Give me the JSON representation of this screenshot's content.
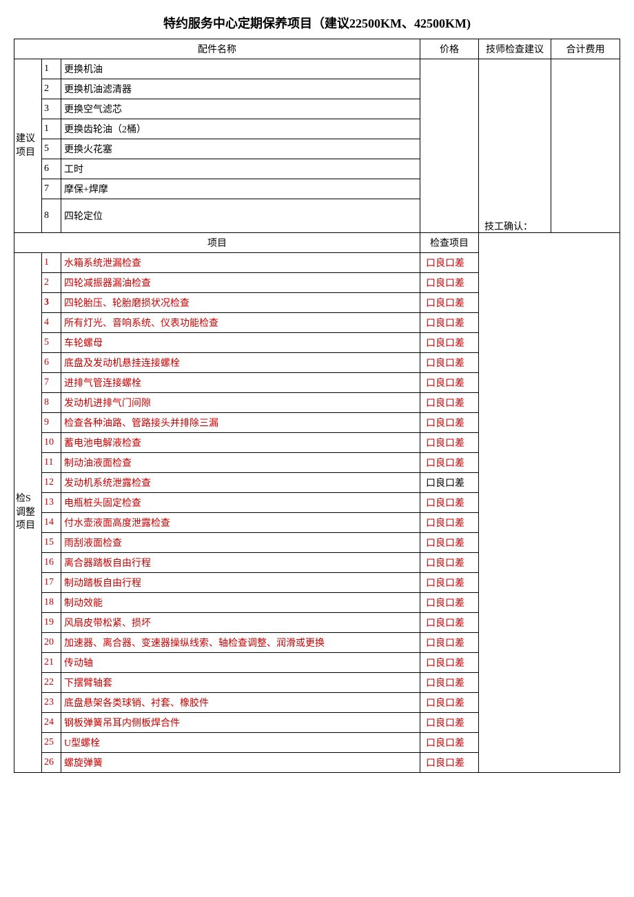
{
  "title": "特约服务中心定期保养项目（建议22500KM、42500KM)",
  "headers": {
    "part_name": "配件名称",
    "price": "价格",
    "advise": "技师检查建议",
    "total": "合计费用",
    "project": "项目",
    "check_project": "检查项目"
  },
  "group1_label": "建议项目",
  "group1": [
    {
      "n": "1",
      "name": "更换机油"
    },
    {
      "n": "2",
      "name": "更换机油滤清器"
    },
    {
      "n": "3",
      "name": "更换空气滤芯"
    },
    {
      "n": "1",
      "name": "更换齿轮油（2桶）"
    },
    {
      "n": "5",
      "name": "更换火花塞"
    },
    {
      "n": "6",
      "name": "工时"
    },
    {
      "n": "7",
      "name": "摩保+焊摩"
    },
    {
      "n": "8",
      "name": "四轮定位"
    }
  ],
  "group2_label": "检S调整项目",
  "check_text": "口良口差",
  "group2": [
    {
      "n": "1",
      "name": "水箱系统泄漏检查"
    },
    {
      "n": "2",
      "name": "四轮减振器漏油检查"
    },
    {
      "n": "3",
      "name": "四轮胎压、轮胎磨损状况检查"
    },
    {
      "n": "4",
      "name": "所有灯光、音响系统、仪表功能检查"
    },
    {
      "n": "5",
      "name": "车轮螺母"
    },
    {
      "n": "6",
      "name": "底盘及发动机悬挂连接螺栓"
    },
    {
      "n": "7",
      "name": "进排气管连接螺栓"
    },
    {
      "n": "8",
      "name": "发动机进排气门间隙"
    },
    {
      "n": "9",
      "name": "检查各种油路、管路接头并排除三漏"
    },
    {
      "n": "10",
      "name": "蓄电池电解液检查"
    },
    {
      "n": "11",
      "name": "制动油液面检查"
    },
    {
      "n": "12",
      "name": "发动机系统泄露检查"
    },
    {
      "n": "13",
      "name": "电瓶桩头固定检查"
    },
    {
      "n": "14",
      "name": "付水壶液面高度泄露检查"
    },
    {
      "n": "15",
      "name": "雨刮液面检查"
    },
    {
      "n": "16",
      "name": "离合器踏板自由行程"
    },
    {
      "n": "17",
      "name": "制动踏板自由行程"
    },
    {
      "n": "18",
      "name": "制动效能"
    },
    {
      "n": "19",
      "name": "风扇皮带松紧、损坏"
    },
    {
      "n": "20",
      "name": "加速器、离合器、变速器操纵线索、轴检查调整、润滑或更换"
    },
    {
      "n": "21",
      "name": "传动轴"
    },
    {
      "n": "22",
      "name": "下摆臂轴套"
    },
    {
      "n": "23",
      "name": "底盘悬架各类球销、衬套、橡胶件"
    },
    {
      "n": "24",
      "name": "钢板弹簧吊耳内侧板焊合件"
    },
    {
      "n": "25",
      "name": "U型螺栓"
    },
    {
      "n": "26",
      "name": "螺旋弹簧"
    }
  ],
  "confirm_label": "技工确认："
}
